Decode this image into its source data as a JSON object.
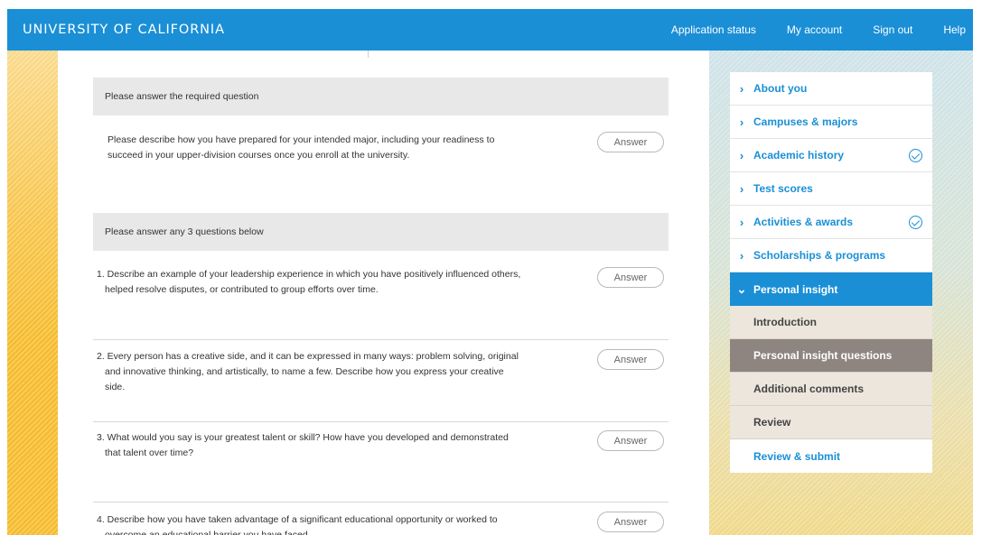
{
  "header": {
    "brand": "UNIVERSITY OF CALIFORNIA",
    "nav": [
      "Application status",
      "My account",
      "Sign out",
      "Help"
    ]
  },
  "required": {
    "header": "Please answer the required question",
    "question_line1": "Please describe how you have prepared for your intended major, including your readiness to",
    "question_line2": "succeed in your upper-division courses once you enroll at the university.",
    "answer_label": "Answer"
  },
  "optional": {
    "header": "Please answer any 3 questions below",
    "questions": [
      {
        "line1": "1. Describe an example of your leadership experience in which you have positively influenced others,",
        "line2": "helped resolve disputes, or contributed to group efforts over time.",
        "line3": ""
      },
      {
        "line1": "2. Every person has a creative side, and it can be expressed in many ways: problem solving, original",
        "line2": "and innovative thinking, and artistically, to name a few. Describe how you express your creative",
        "line3": "side."
      },
      {
        "line1": "3. What would you say is your greatest talent or skill? How have you developed and demonstrated",
        "line2": "that talent over time?",
        "line3": ""
      },
      {
        "line1": "4. Describe how you have taken advantage of a significant educational opportunity or worked to",
        "line2": "overcome an educational barrier you have faced.",
        "line3": ""
      }
    ],
    "answer_label": "Answer"
  },
  "sidebar": {
    "items": [
      {
        "label": "About you",
        "completed": false
      },
      {
        "label": "Campuses & majors",
        "completed": false
      },
      {
        "label": "Academic history",
        "completed": true
      },
      {
        "label": "Test scores",
        "completed": false
      },
      {
        "label": "Activities & awards",
        "completed": true
      },
      {
        "label": "Scholarships & programs",
        "completed": false
      },
      {
        "label": "Personal insight",
        "completed": false
      }
    ],
    "subitems": [
      "Introduction",
      "Personal insight questions",
      "Additional comments",
      "Review"
    ],
    "final": "Review & submit"
  },
  "colors": {
    "accent": "#1a8fd6",
    "selected_sub": "#8e8580",
    "sub_bg": "#ece6dd"
  }
}
